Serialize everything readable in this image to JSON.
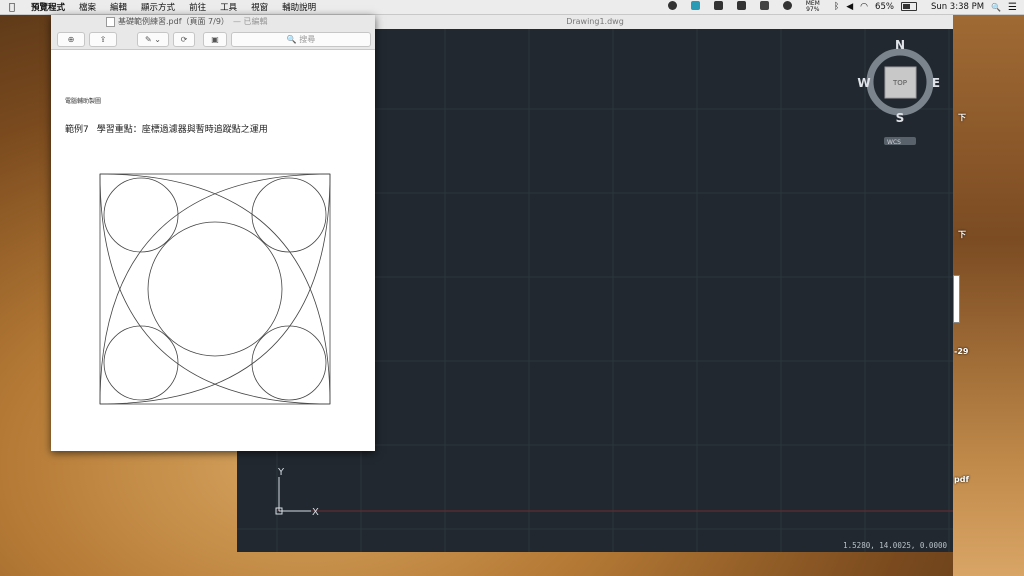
{
  "menubar": {
    "apple": "",
    "items": [
      "預覽程式",
      "檔案",
      "編輯",
      "顯示方式",
      "前往",
      "工具",
      "視窗",
      "輔助說明"
    ],
    "status": {
      "mem": "MEM",
      "mem_pct": "97%",
      "battery_pct": "65%",
      "clock": "Sun 3:38 PM",
      "search_icon": "🔍"
    }
  },
  "preview_window": {
    "file_title": "基礎範例練習.pdf（頁面 7/9）",
    "edited_label": "— 已編輯",
    "search_placeholder": "搜尋",
    "page_small_text": "電腦輔助製圖",
    "heading_example": "範例7",
    "heading_focus": "學習重點：座標過濾器與暫時追蹤點之運用"
  },
  "autocad": {
    "title": "Drawing1.dwg",
    "viewcube": {
      "n": "N",
      "s": "S",
      "e": "E",
      "w": "W",
      "top": "TOP",
      "wcs": "WCS"
    },
    "ucs": {
      "x": "X",
      "y": "Y"
    },
    "coordinates": "1.5280, 14.0025, 0.0000"
  },
  "desktop_labels": [
    "下",
    "下",
    "-29",
    "pdf"
  ],
  "colors": {
    "cad_bg": "#212830",
    "menubar_bg": "#ececec"
  }
}
